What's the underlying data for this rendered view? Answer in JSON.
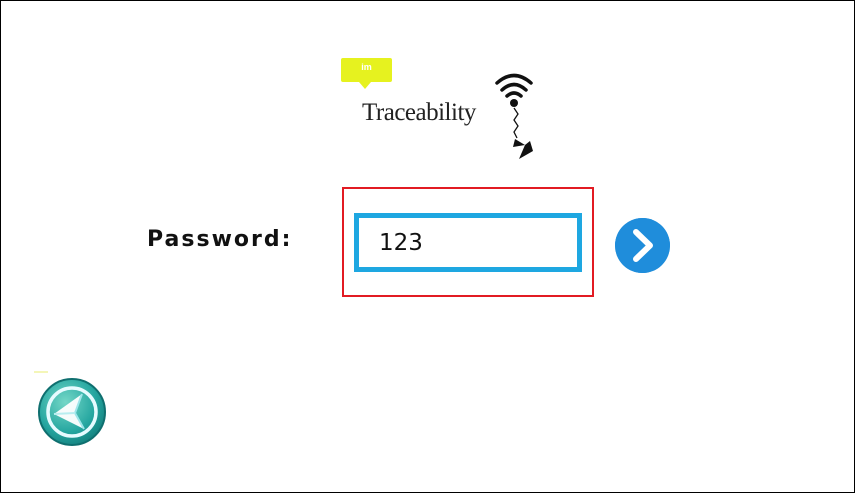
{
  "logo": {
    "badge_text": "im",
    "brand_name": "Traceability"
  },
  "login": {
    "password_label": "Password:",
    "password_value": "123"
  },
  "icons": {
    "logo_signal": "wifi-signal-icon",
    "submit": "chevron-right-circle-icon",
    "back": "back-arrow-circle-icon"
  },
  "colors": {
    "logo_badge": "#e6f21f",
    "field_border": "#1ea7e1",
    "highlight_frame": "#e21b23",
    "submit_button": "#1f8ddb",
    "back_button": "#25a6a0"
  }
}
